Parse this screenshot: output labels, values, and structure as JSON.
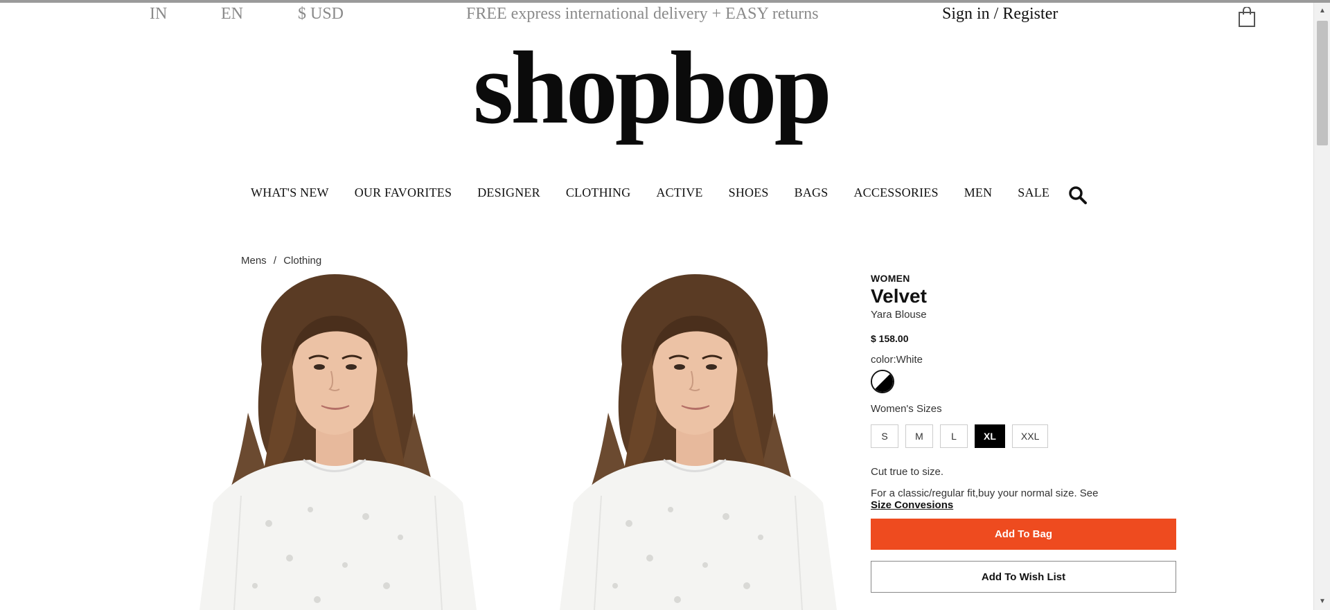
{
  "utility": {
    "country": "IN",
    "language": "EN",
    "currency": "$ USD",
    "promo": "FREE express international delivery + EASY returns",
    "signin": "Sign in / Register",
    "bag_icon": "shopping-bag-icon"
  },
  "logo": {
    "text": "shopbop"
  },
  "nav": {
    "items": [
      "WHAT'S NEW",
      "OUR FAVORITES",
      "DESIGNER",
      "CLOTHING",
      "ACTIVE",
      "SHOES",
      "BAGS",
      "ACCESSORIES",
      "MEN",
      "SALE"
    ],
    "search_icon": "search-icon"
  },
  "breadcrumb": {
    "items": [
      "Mens",
      "/",
      "Clothing"
    ]
  },
  "product": {
    "gender": "WOMEN",
    "brand": "Velvet",
    "name": "Yara Blouse",
    "price": "$ 158.00",
    "color_label": "color:White",
    "sizes_label": "Women's Sizes",
    "sizes": [
      "S",
      "M",
      "L",
      "XL",
      "XXL"
    ],
    "selected_size": "XL",
    "fit_note": "Cut true to size.",
    "fit_advice": "For a classic/regular fit,buy your normal size. See",
    "size_link": "Size Convesions",
    "add_to_bag": "Add To Bag",
    "add_to_wishlist": "Add To Wish List"
  },
  "colors": {
    "accent": "#ee4b1f",
    "selected_size_bg": "#000000",
    "muted_text": "#8a8a8a"
  }
}
